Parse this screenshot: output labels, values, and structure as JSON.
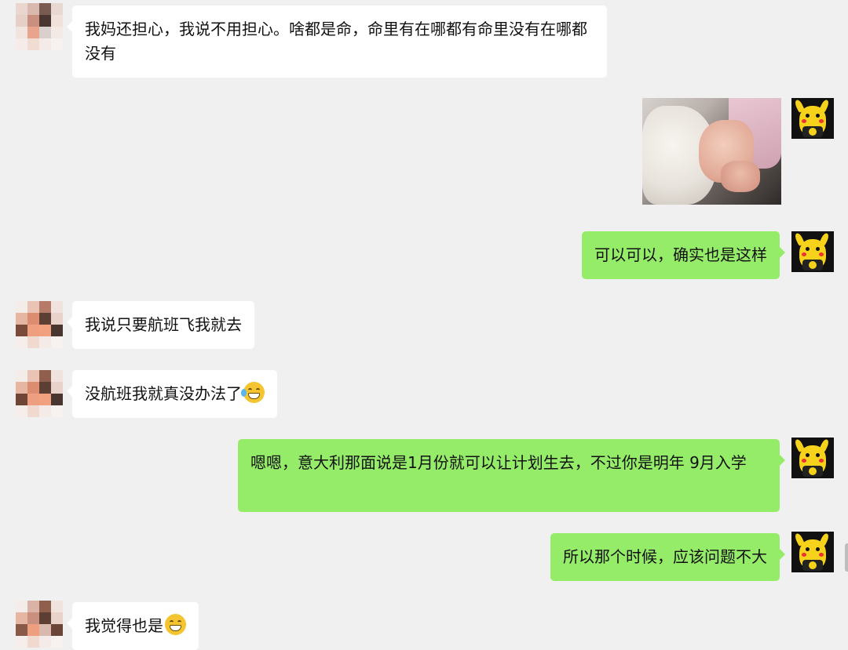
{
  "messages": [
    {
      "side": "left",
      "text": "我妈还担心，我说不用担心。啥都是命，命里有在哪都有命里没有在哪都没有"
    },
    {
      "side": "right",
      "type": "image",
      "alt": ""
    },
    {
      "side": "right",
      "text": "可以可以，确实也是这样"
    },
    {
      "side": "left",
      "text": "我说只要航班飞我就去"
    },
    {
      "side": "left",
      "text": "没航班我就真没办法了",
      "emoji": "laugh-tear-emoji"
    },
    {
      "side": "right",
      "text": "嗯嗯，意大利那面说是1月份就可以让计划生去，不过你是明年 9月入学"
    },
    {
      "side": "right",
      "text": "所以那个时候，应该问题不大"
    },
    {
      "side": "left",
      "text": "我觉得也是",
      "emoji": "grin-emoji"
    }
  ],
  "colors": {
    "background": "#f0f0f0",
    "incoming_bubble": "#ffffff",
    "outgoing_bubble": "#95ec69"
  }
}
